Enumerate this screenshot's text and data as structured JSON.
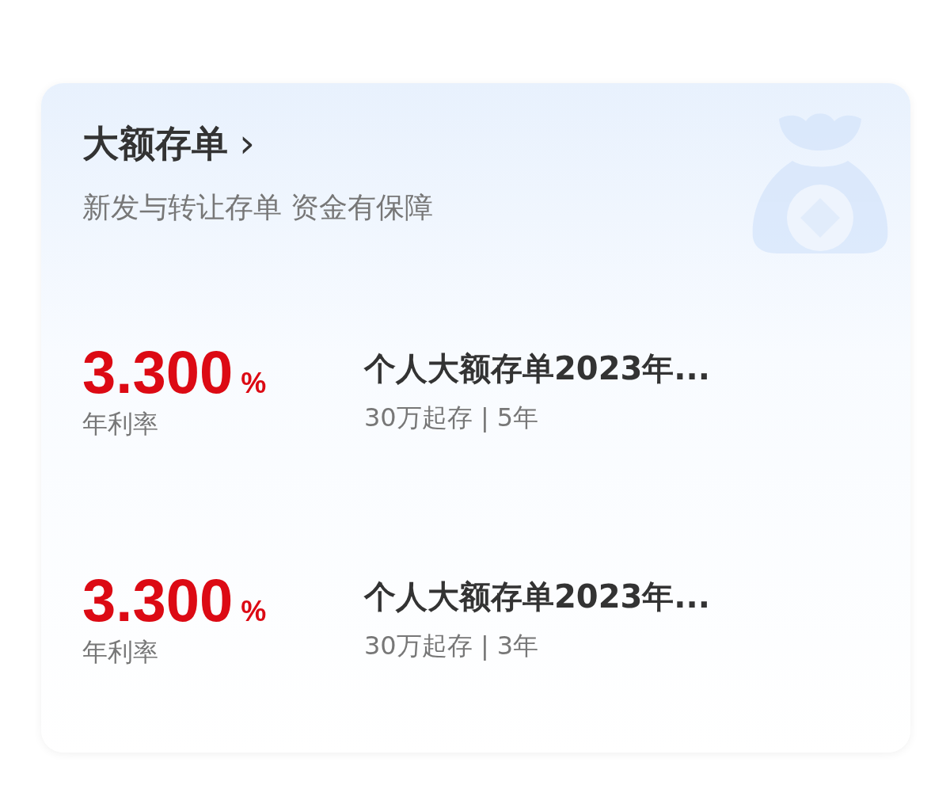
{
  "card": {
    "title": "大额存单",
    "title_arrow": "›",
    "subtitle": "新发与转让存单 资金有保障",
    "products": [
      {
        "rate": "3.300",
        "unit": "%",
        "rate_label": "年利率",
        "name": "个人大额存单2023年...",
        "detail": "30万起存 | 5年"
      },
      {
        "rate": "3.300",
        "unit": "%",
        "rate_label": "年利率",
        "name": "个人大额存单2023年...",
        "detail": "30万起存 | 3年"
      }
    ]
  }
}
